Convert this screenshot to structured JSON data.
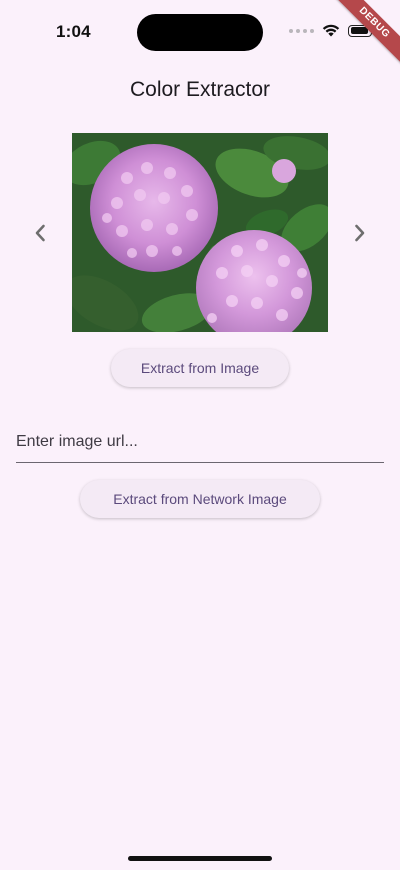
{
  "status_bar": {
    "time": "1:04",
    "icons": [
      "signal-dots-icon",
      "wifi-icon",
      "battery-icon"
    ]
  },
  "debug_banner": {
    "label": "DEBUG",
    "color": "#b5484b"
  },
  "app": {
    "title": "Color Extractor"
  },
  "carousel": {
    "prev_icon": "chevron-left-icon",
    "next_icon": "chevron-right-icon",
    "image_subject": "pink hydrangea flowers"
  },
  "buttons": {
    "extract_image": "Extract from Image",
    "extract_network": "Extract from Network Image"
  },
  "url_field": {
    "placeholder": "Enter image url...",
    "value": ""
  },
  "colors": {
    "background": "#fbf1fb",
    "button_bg": "#f4eaf5",
    "button_text": "#5b4a7c"
  }
}
